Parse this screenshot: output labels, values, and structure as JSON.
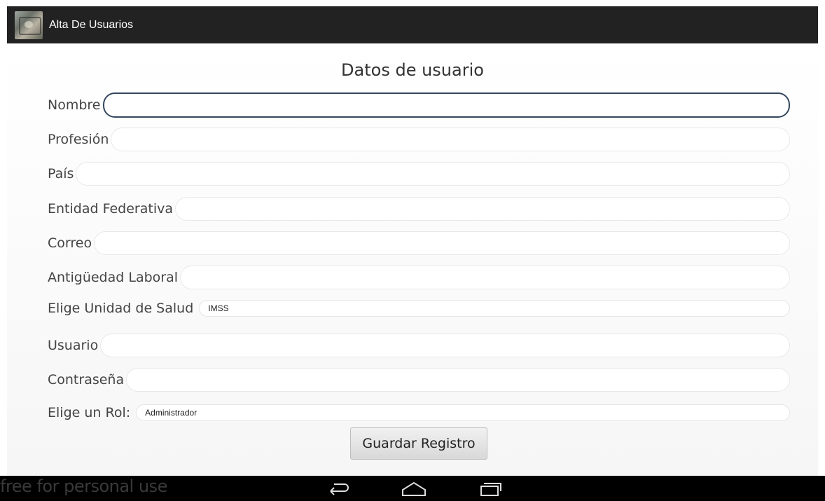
{
  "app_bar": {
    "title": "Alta De Usuarios",
    "icon": "app-logo-icon"
  },
  "form": {
    "title": "Datos de usuario",
    "fields": {
      "nombre": {
        "label": "Nombre",
        "value": ""
      },
      "profesion": {
        "label": "Profesión",
        "value": ""
      },
      "pais": {
        "label": "País",
        "value": ""
      },
      "entidad": {
        "label": "Entidad Federativa",
        "value": ""
      },
      "correo": {
        "label": "Correo",
        "value": ""
      },
      "antiguedad": {
        "label": "Antigüedad Laboral",
        "value": ""
      },
      "unidad": {
        "label": "Elige Unidad de Salud",
        "selected": "IMSS"
      },
      "usuario": {
        "label": "Usuario",
        "value": ""
      },
      "contrasena": {
        "label": "Contraseña",
        "value": ""
      },
      "rol": {
        "label": "Elige un Rol:",
        "selected": "Administrador"
      }
    },
    "save_label": "Guardar Registro"
  },
  "nav_bar": {
    "watermark": "free for personal use",
    "icons": [
      "back-icon",
      "home-icon",
      "recent-apps-icon"
    ]
  },
  "colors": {
    "app_bar_bg": "#222222",
    "focus_border": "#35475e",
    "nav_bar_bg": "#000000"
  }
}
